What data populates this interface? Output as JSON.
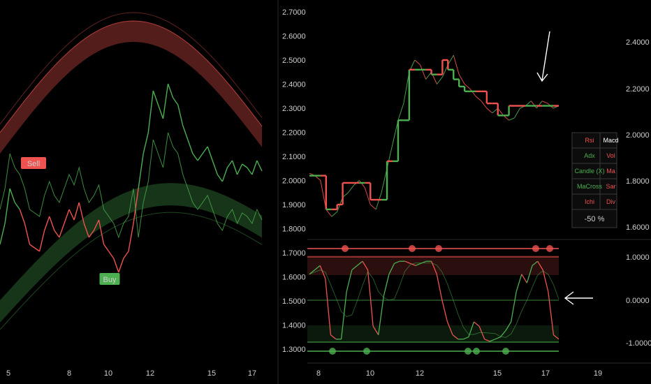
{
  "colors": {
    "bg": "#000000",
    "bull": "#4caf50",
    "bear": "#ef5350",
    "grid": "#1a1a1a",
    "divider": "#2a2a2a",
    "text": "#cfcfcf"
  },
  "left_chart": {
    "xticks": [
      "5",
      "8",
      "10",
      "12",
      "15",
      "17"
    ],
    "signals": [
      {
        "label": "Sell",
        "type": "sell"
      },
      {
        "label": "Buy",
        "type": "buy"
      }
    ]
  },
  "top_chart": {
    "price_axis": [
      "2.7000",
      "2.6000",
      "2.5000",
      "2.4000",
      "2.3000",
      "2.2000",
      "2.1000",
      "2.0000",
      "1.9000",
      "1.8000",
      "1.7000",
      "1.6000",
      "1.5000",
      "1.4000",
      "1.3000"
    ],
    "right_axis": [
      "2.4000",
      "2.2000",
      "2.0000",
      "1.8000",
      "1.6000"
    ]
  },
  "dashboard": {
    "rows": [
      {
        "left": "Rsi",
        "left_state": "bear",
        "right": "Macd",
        "right_state": "neutral"
      },
      {
        "left": "Adx",
        "left_state": "bull",
        "right": "Vol",
        "right_state": "bear"
      },
      {
        "left": "Candle (X)",
        "left_state": "bull",
        "right": "Ma",
        "right_state": "bear"
      },
      {
        "left": "MaCross",
        "left_state": "bull",
        "right": "Sar",
        "right_state": "bear"
      },
      {
        "left": "Ichi",
        "left_state": "bear",
        "right": "Div",
        "right_state": "bear"
      }
    ],
    "summary": "-50 %"
  },
  "oscillator": {
    "right_axis": [
      "1.0000",
      "0.0000",
      "-1.0000"
    ]
  },
  "bottom_axis": [
    "8",
    "10",
    "12",
    "15",
    "17",
    "19"
  ],
  "chart_data": [
    {
      "type": "line",
      "title": "",
      "xlabel": "",
      "ylabel": "",
      "x_ticks": [
        "5",
        "8",
        "10",
        "12",
        "15",
        "17"
      ],
      "series": [
        {
          "values": [
            1.0,
            1.3,
            1.8,
            1.6,
            1.5,
            1.3,
            1.0,
            0.95,
            0.9,
            1.2,
            1.4,
            1.2,
            1.1,
            1.3,
            1.5,
            1.35,
            1.6,
            1.3,
            1.1,
            1.2,
            1.35,
            1.0,
            0.9,
            0.8,
            0.6,
            0.8,
            0.9,
            1.3,
            1.8,
            2.3,
            2.6,
            3.2,
            3.0,
            2.8,
            3.3,
            3.1,
            3.0,
            2.7,
            2.5,
            2.3,
            2.2,
            2.3,
            2.4,
            2.2,
            2.0,
            1.9,
            2.1,
            2.2,
            2.0,
            2.15,
            2.1,
            2.0,
            2.2,
            2.05
          ]
        }
      ]
    },
    {
      "type": "line",
      "title": "",
      "y_axis_ticks": [
        "2.7000",
        "2.6000",
        "2.5000",
        "2.4000",
        "2.3000",
        "2.2000",
        "2.1000",
        "2.0000",
        "1.9000",
        "1.8000"
      ],
      "x_ticks": [
        "8",
        "10",
        "12",
        "15",
        "17",
        "19"
      ],
      "series": [
        {
          "values": [
            2.03,
            2.02,
            2.0,
            1.88,
            1.85,
            1.87,
            1.93,
            1.95,
            1.98,
            2.0,
            1.97,
            1.9,
            1.88,
            1.95,
            2.05,
            2.15,
            2.25,
            2.32,
            2.45,
            2.5,
            2.48,
            2.42,
            2.45,
            2.4,
            2.43,
            2.48,
            2.52,
            2.44,
            2.4,
            2.38,
            2.35,
            2.33,
            2.3,
            2.28,
            2.3,
            2.27,
            2.25,
            2.26,
            2.3,
            2.31,
            2.33,
            2.3,
            2.33,
            2.32,
            2.3,
            2.31
          ]
        },
        {
          "values": [
            2.02,
            2.02,
            2.02,
            1.88,
            1.88,
            1.9,
            1.99,
            1.99,
            1.99,
            1.99,
            1.99,
            1.92,
            1.92,
            1.92,
            2.08,
            2.08,
            2.25,
            2.25,
            2.46,
            2.46,
            2.46,
            2.46,
            2.44,
            2.44,
            2.5,
            2.46,
            2.42,
            2.39,
            2.37,
            2.37,
            2.37,
            2.37,
            2.32,
            2.32,
            2.27,
            2.27,
            2.31,
            2.31,
            2.31,
            2.31,
            2.31,
            2.31,
            2.31,
            2.31,
            2.31,
            2.31
          ]
        }
      ]
    },
    {
      "type": "line",
      "title": "",
      "y_axis_ticks": [
        "1.0000",
        "0.0000",
        "-1.0000"
      ],
      "series": [
        {
          "values": [
            0.6,
            0.7,
            0.8,
            0.5,
            -0.8,
            -0.9,
            -0.9,
            0.2,
            0.7,
            0.8,
            0.9,
            0.7,
            -0.6,
            -0.8,
            0.1,
            0.6,
            0.85,
            0.9,
            0.9,
            0.85,
            0.8,
            0.85,
            0.9,
            0.9,
            0.6,
            0.0,
            -0.5,
            -0.8,
            -0.9,
            -0.9,
            -0.85,
            -0.5,
            -0.6,
            -0.9,
            -0.95,
            -0.9,
            -0.85,
            -0.7,
            -0.5,
            0.2,
            0.6,
            0.4,
            0.8,
            0.9,
            0.7,
            0.2,
            -0.8,
            -0.9
          ]
        }
      ]
    }
  ]
}
